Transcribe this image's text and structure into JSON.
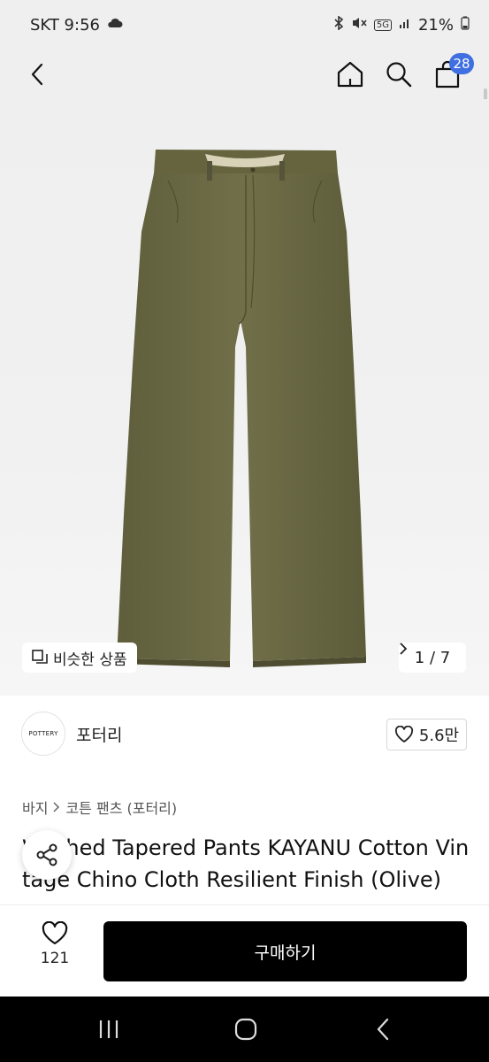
{
  "status_bar": {
    "carrier_time": "SKT 9:56",
    "network": "5G",
    "battery": "21%"
  },
  "header": {
    "cart_count": "28"
  },
  "gallery": {
    "similar_label": "비슷한 상품",
    "page_indicator": "1 / 7"
  },
  "brand": {
    "logo_text": "POTTERY",
    "name": "포터리",
    "likes": "5.6만"
  },
  "breadcrumb": {
    "level1": "바지",
    "level2": "코튼 팬츠 (포터리)"
  },
  "product": {
    "title": "Washed Tapered Pants KAYANU Cotton Vintage Chino Cloth Resilient Finish (Olive)"
  },
  "actions": {
    "wish_count": "121",
    "buy_label": "구매하기"
  },
  "colors": {
    "accent": "#3f6fe0",
    "pants": "#6b6a45",
    "buy_button": "#000000"
  }
}
